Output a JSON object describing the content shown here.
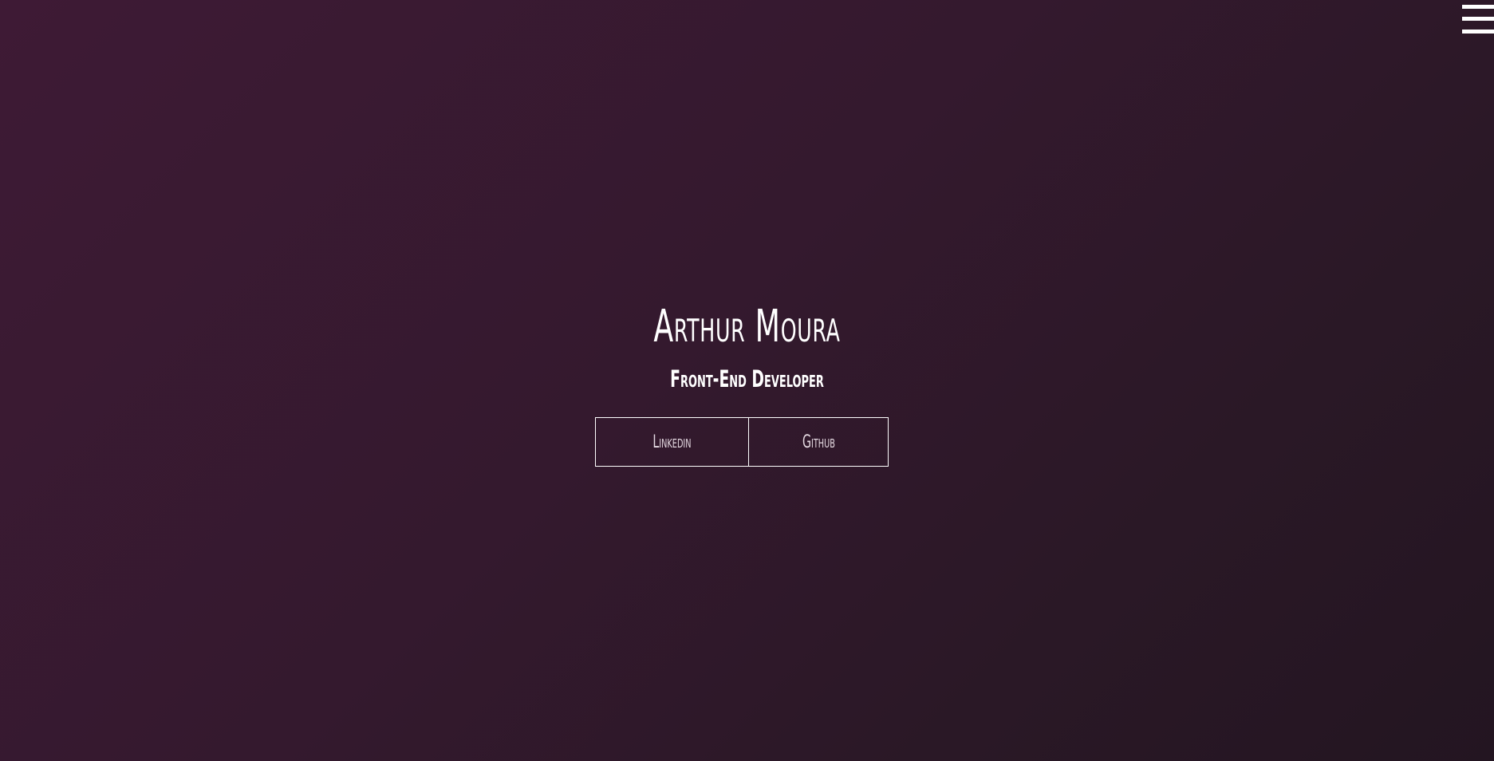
{
  "header": {
    "menu_icon": "hamburger-menu-icon"
  },
  "hero": {
    "name": "Arthur Moura",
    "role": "Front-End Developer"
  },
  "links": [
    {
      "label": "Linkedin"
    },
    {
      "label": "Github"
    }
  ],
  "colors": {
    "background_start": "#3e1a35",
    "background_end": "#231521",
    "text": "#ffffff",
    "button_border": "#ffffff"
  }
}
